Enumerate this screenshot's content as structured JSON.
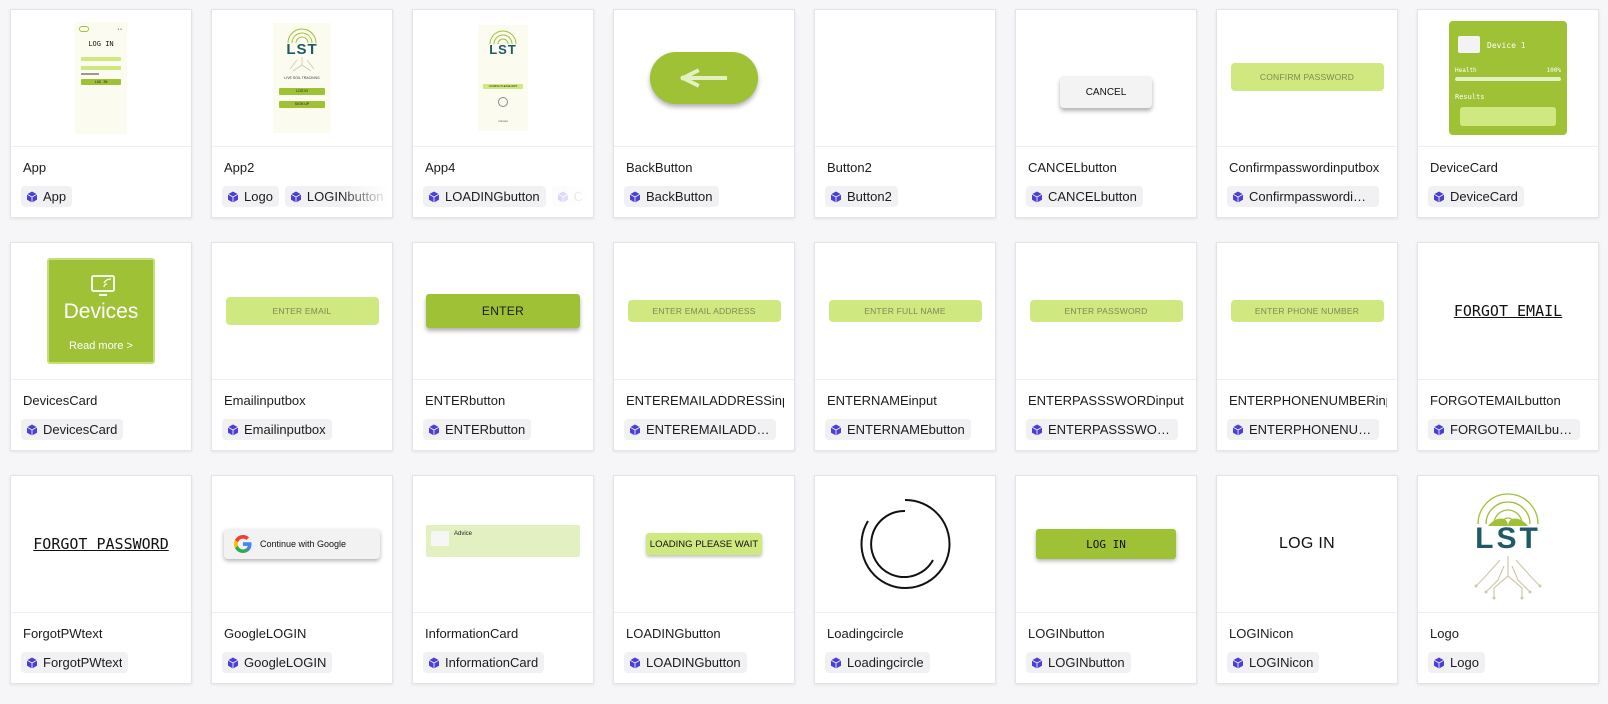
{
  "colors": {
    "lime": "#9ec136",
    "lime_light": "#d0e880",
    "lime_pale": "#e3f1c2",
    "tag_icon": "#4b3fd6",
    "teal": "#1f5a66"
  },
  "cards": [
    {
      "name": "App",
      "tags": [
        {
          "label": "App"
        }
      ],
      "preview": {
        "phone_title": "LOG IN",
        "button": "LOG IN"
      }
    },
    {
      "name": "App2",
      "tags": [
        {
          "label": "Logo"
        },
        {
          "label": "LOGINbutton"
        }
      ],
      "preview": {
        "logo": "LST",
        "caption": "LIVE SOIL TRACKING",
        "button1": "LOG IN",
        "button2": "SIGN UP"
      }
    },
    {
      "name": "App4",
      "tags": [
        {
          "label": "LOADINGbutton"
        },
        {
          "label": "C"
        }
      ],
      "preview": {
        "logo": "LST",
        "button": "LOADING PLEASE WAIT",
        "footer": "Cancel"
      }
    },
    {
      "name": "BackButton",
      "tags": [
        {
          "label": "BackButton"
        }
      ],
      "preview": {
        "icon": "back-arrow-icon"
      }
    },
    {
      "name": "Button2",
      "tags": [
        {
          "label": "Button2"
        }
      ],
      "preview": {}
    },
    {
      "name": "CANCELbutton",
      "tags": [
        {
          "label": "CANCELbutton"
        }
      ],
      "preview": {
        "label": "CANCEL"
      }
    },
    {
      "name": "Confirmpasswordinputbox",
      "tags": [
        {
          "label": "Confirmpasswordinputbox"
        }
      ],
      "preview": {
        "placeholder": "CONFIRM PASSWORD"
      }
    },
    {
      "name": "DeviceCard",
      "tags": [
        {
          "label": "DeviceCard"
        }
      ],
      "preview": {
        "title": "Device 1",
        "health_label": "Health",
        "health_value": "100%",
        "health_fraction": 1.0,
        "results_label": "Results"
      }
    },
    {
      "name": "DevicesCard",
      "tags": [
        {
          "label": "DevicesCard"
        }
      ],
      "preview": {
        "icon": "cast-screen-icon",
        "title": "Devices",
        "link": "Read more >"
      }
    },
    {
      "name": "Emailinputbox",
      "tags": [
        {
          "label": "Emailinputbox"
        }
      ],
      "preview": {
        "placeholder": "ENTER EMAIL"
      }
    },
    {
      "name": "ENTERbutton",
      "tags": [
        {
          "label": "ENTERbutton"
        }
      ],
      "preview": {
        "label": "ENTER"
      }
    },
    {
      "name": "ENTEREMAILADDRESSinput",
      "tags": [
        {
          "label": "ENTEREMAILADDRESSinput"
        }
      ],
      "preview": {
        "placeholder": "ENTER EMAIL ADDRESS"
      }
    },
    {
      "name": "ENTERNAMEinput",
      "tags": [
        {
          "label": "ENTERNAMEbutton"
        }
      ],
      "preview": {
        "placeholder": "ENTER FULL NAME"
      }
    },
    {
      "name": "ENTERPASSSWORDinput",
      "tags": [
        {
          "label": "ENTERPASSSWORDinput"
        }
      ],
      "preview": {
        "placeholder": "ENTER PASSWORD"
      }
    },
    {
      "name": "ENTERPHONENUMBERinput",
      "tags": [
        {
          "label": "ENTERPHONENUMBERinput"
        }
      ],
      "preview": {
        "placeholder": "ENTER PHONE NUMBER"
      }
    },
    {
      "name": "FORGOTEMAILbutton",
      "tags": [
        {
          "label": "FORGOTEMAILbutton"
        }
      ],
      "preview": {
        "label": "FORGOT EMAIL"
      }
    },
    {
      "name": "ForgotPWtext",
      "tags": [
        {
          "label": "ForgotPWtext"
        }
      ],
      "preview": {
        "label": "FORGOT PASSWORD"
      }
    },
    {
      "name": "GoogleLOGIN",
      "tags": [
        {
          "label": "GoogleLOGIN"
        }
      ],
      "preview": {
        "label": "Continue with Google"
      }
    },
    {
      "name": "InformationCard",
      "tags": [
        {
          "label": "InformationCard"
        }
      ],
      "preview": {
        "label": "Advice"
      }
    },
    {
      "name": "LOADINGbutton",
      "tags": [
        {
          "label": "LOADINGbutton"
        }
      ],
      "preview": {
        "label": "LOADING PLEASE WAIT"
      }
    },
    {
      "name": "Loadingcircle",
      "tags": [
        {
          "label": "Loadingcircle"
        }
      ],
      "preview": {
        "icon": "loading-circle-icon"
      }
    },
    {
      "name": "LOGINbutton",
      "tags": [
        {
          "label": "LOGINbutton"
        }
      ],
      "preview": {
        "label": "LOG IN"
      }
    },
    {
      "name": "LOGINicon",
      "tags": [
        {
          "label": "LOGINicon"
        }
      ],
      "preview": {
        "label": "LOG IN"
      }
    },
    {
      "name": "Logo",
      "tags": [
        {
          "label": "Logo"
        }
      ],
      "preview": {
        "logo": "LST"
      }
    }
  ]
}
